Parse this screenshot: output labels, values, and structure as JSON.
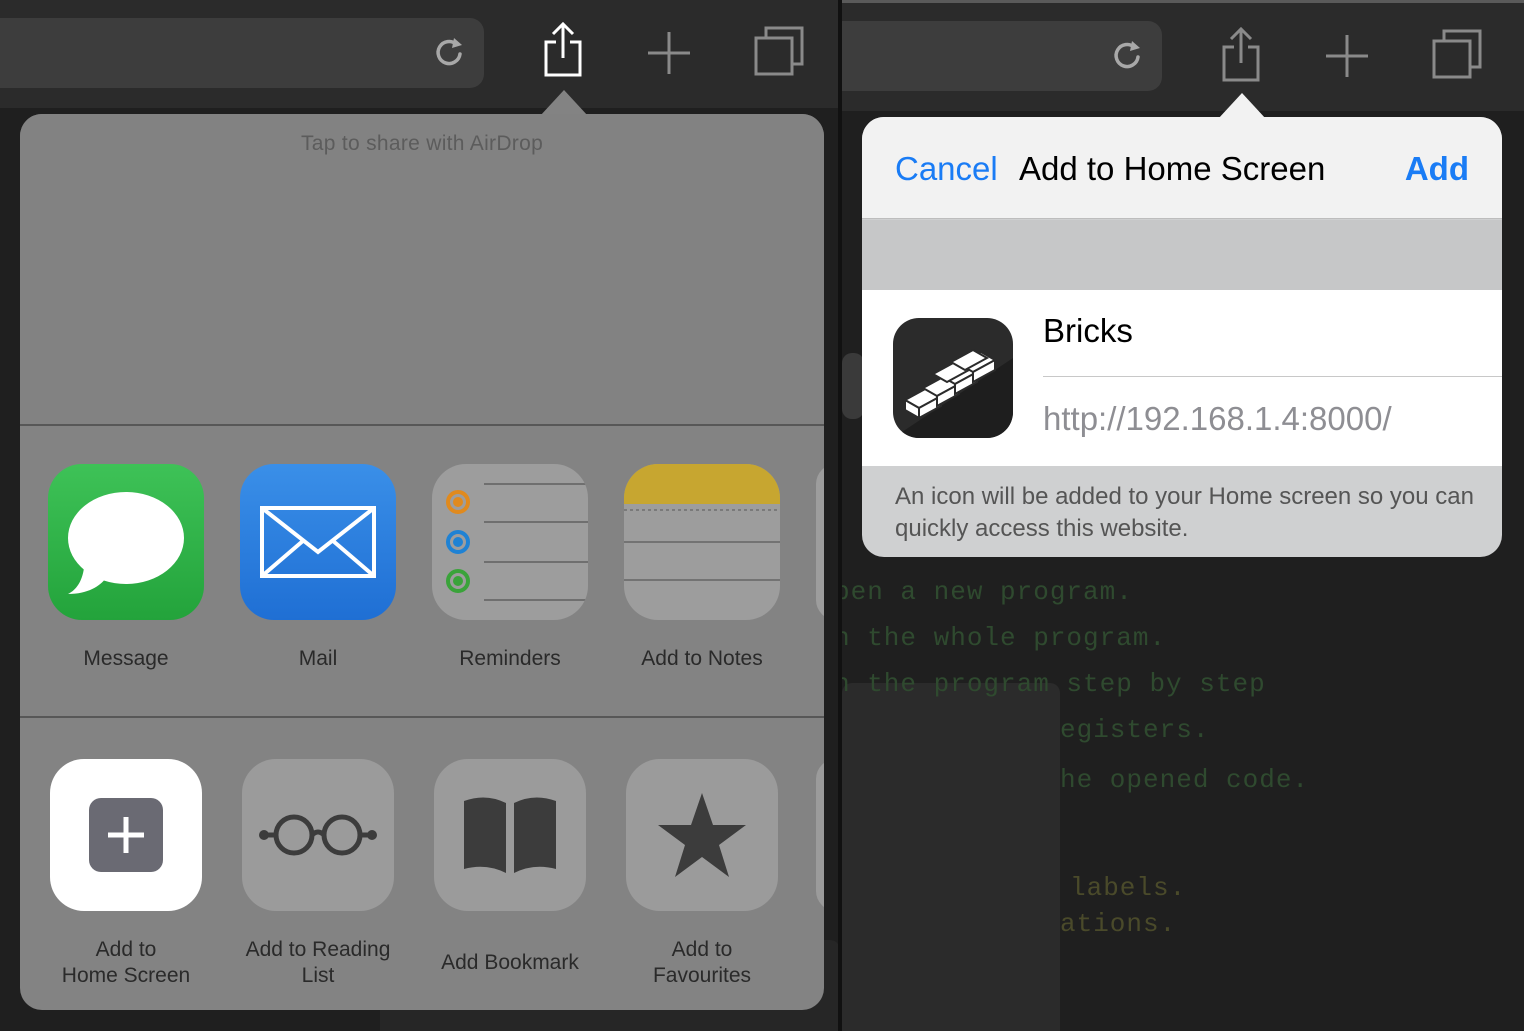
{
  "share_sheet": {
    "airdrop_hint": "Tap to share with AirDrop",
    "apps": [
      {
        "label": "Message",
        "icon": "message-icon"
      },
      {
        "label": "Mail",
        "icon": "mail-icon"
      },
      {
        "label": "Reminders",
        "icon": "reminders-icon"
      },
      {
        "label": "Add to Notes",
        "icon": "notes-icon"
      }
    ],
    "actions": [
      {
        "label_line1": "Add to",
        "label_line2": "Home Screen",
        "icon": "plus-square-icon"
      },
      {
        "label_line1": "Add to Reading",
        "label_line2": "List",
        "icon": "glasses-icon"
      },
      {
        "label_line1": "Add Bookmark",
        "label_line2": "",
        "icon": "book-icon"
      },
      {
        "label_line1": "Add to",
        "label_line2": "Favourites",
        "icon": "star-icon"
      }
    ]
  },
  "dialog": {
    "cancel_label": "Cancel",
    "title": "Add to Home Screen",
    "add_label": "Add",
    "app_name": "Bricks",
    "url": "http://192.168.1.4:8000/",
    "note": "An icon will be added to your Home screen so you can quickly access this website."
  },
  "background_page": {
    "lines": [
      "pen a new program.",
      "n the whole program.",
      "n the program step by step",
      "egisters.",
      "he opened code.",
      "labels.",
      "ations."
    ]
  },
  "colors": {
    "accent": "#1a7cf5",
    "message_green": "#2fb34a",
    "mail_blue": "#2a7ee0",
    "notes_yellow": "#e6c13a"
  }
}
